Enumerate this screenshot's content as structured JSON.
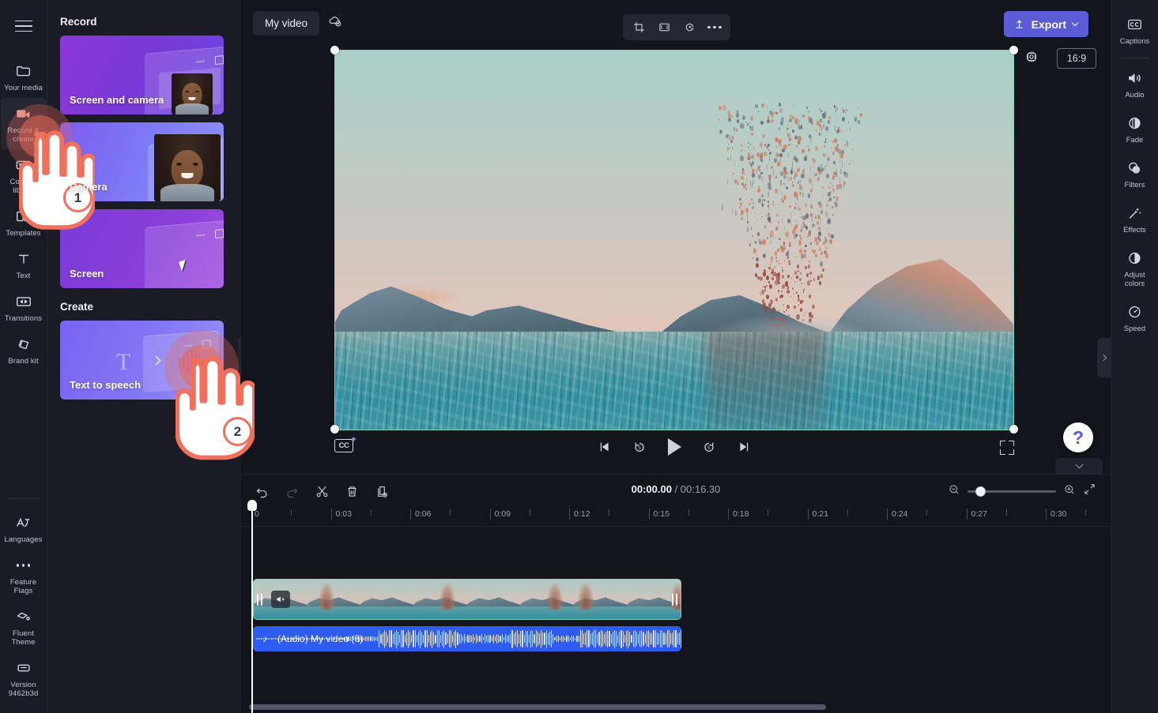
{
  "app": {
    "left_rail": {
      "menu_icon": "hamburger-icon",
      "items": [
        {
          "label": "Your media",
          "icon": "folder-icon",
          "active": false
        },
        {
          "label": "Record & create",
          "icon": "video-camera-icon",
          "active": true
        },
        {
          "label": "Content library",
          "icon": "content-library-icon",
          "active": false
        },
        {
          "label": "Templates",
          "icon": "templates-icon",
          "active": false
        },
        {
          "label": "Text",
          "icon": "text-t-icon",
          "active": false
        },
        {
          "label": "Transitions",
          "icon": "transitions-icon",
          "active": false
        },
        {
          "label": "Brand kit",
          "icon": "brand-kit-icon",
          "active": false
        }
      ],
      "bottom_items": [
        {
          "label": "Languages",
          "icon": "languages-icon"
        },
        {
          "label": "Feature Flags",
          "icon": "ellipsis-icon"
        },
        {
          "label": "Fluent Theme",
          "icon": "fluent-theme-icon"
        },
        {
          "label": "Version 9462b3d",
          "icon": "version-icon"
        }
      ]
    },
    "panel": {
      "record_heading": "Record",
      "create_heading": "Create",
      "record_cards": [
        {
          "label": "Screen and camera"
        },
        {
          "label": "Camera"
        },
        {
          "label": "Screen"
        }
      ],
      "create_cards": [
        {
          "label": "Text to speech"
        }
      ]
    },
    "header": {
      "project_title": "My video",
      "save_status_icon": "cloud-saved-icon",
      "tools": [
        {
          "icon": "crop-icon",
          "name": "crop-tool"
        },
        {
          "icon": "fit-frame-icon",
          "name": "fit-tool"
        },
        {
          "icon": "rotate-icon",
          "name": "rotate-tool"
        },
        {
          "icon": "more-horizontal-icon",
          "name": "more-tool"
        }
      ],
      "export_label": "Export",
      "export_color": "#5b5bd6"
    },
    "stage": {
      "chip_icon": "processor-chip-icon",
      "aspect_ratio": "16:9",
      "selection_color": "#7fd4bc"
    },
    "player": {
      "cc_label": "CC",
      "controls": [
        {
          "name": "skip-to-start-button",
          "icon": "skip-previous-icon"
        },
        {
          "name": "rewind-5-button",
          "icon": "rewind-5-icon",
          "label": "5"
        },
        {
          "name": "play-button",
          "icon": "play-icon"
        },
        {
          "name": "forward-5-button",
          "icon": "forward-5-icon",
          "label": "5"
        },
        {
          "name": "skip-to-end-button",
          "icon": "skip-next-icon"
        }
      ],
      "fullscreen_icon": "fullscreen-icon"
    },
    "right_rail": {
      "primary": {
        "label": "Captions",
        "icon": "closed-caption-icon"
      },
      "items": [
        {
          "label": "Audio",
          "icon": "speaker-icon"
        },
        {
          "label": "Fade",
          "icon": "fade-icon"
        },
        {
          "label": "Filters",
          "icon": "filters-icon"
        },
        {
          "label": "Effects",
          "icon": "magic-wand-icon"
        },
        {
          "label": "Adjust colors",
          "icon": "contrast-icon"
        },
        {
          "label": "Speed",
          "icon": "speedometer-icon"
        }
      ]
    },
    "help": {
      "label": "?"
    },
    "timeline": {
      "tools": [
        {
          "name": "undo-button",
          "icon": "undo-icon",
          "disabled": false
        },
        {
          "name": "redo-button",
          "icon": "redo-icon",
          "disabled": true
        },
        {
          "name": "split-button",
          "icon": "scissors-icon",
          "disabled": false
        },
        {
          "name": "delete-button",
          "icon": "trash-icon",
          "disabled": false
        },
        {
          "name": "duplicate-button",
          "icon": "duplicate-icon",
          "disabled": false
        }
      ],
      "current_time": "00:00.00",
      "total_time": "/ 00:16.30",
      "zoom_out_icon": "zoom-out-icon",
      "zoom_in_icon": "zoom-in-icon",
      "fit_icon": "fit-timeline-icon",
      "ruler_ticks": [
        "0",
        "0:03",
        "0:06",
        "0:09",
        "0:12",
        "0:15",
        "0:18",
        "0:21",
        "0:24",
        "0:27",
        "0:30"
      ],
      "video_clip": {
        "muted": true,
        "mute_icon": "speaker-muted-icon"
      },
      "audio_clip": {
        "label": "(Audio) My video (6)",
        "icon": "music-note-icon",
        "color": "#2f5cf0"
      }
    },
    "annotations": [
      {
        "step": "1",
        "target": "record-and-create-rail-item"
      },
      {
        "step": "2",
        "target": "text-to-speech-card"
      }
    ]
  }
}
